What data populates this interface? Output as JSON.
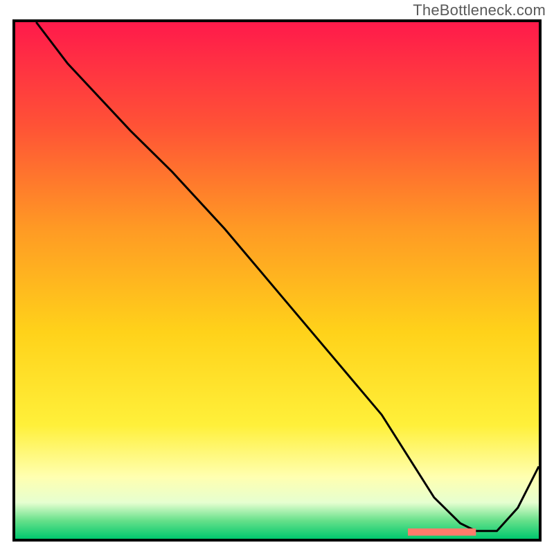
{
  "watermark": {
    "text": "TheBottleneck.com"
  },
  "chart_data": {
    "type": "line",
    "title": "",
    "xlabel": "",
    "ylabel": "",
    "xlim": [
      0,
      100
    ],
    "ylim": [
      0,
      100
    ],
    "grid": false,
    "legend": false,
    "background_gradient": {
      "direction": "vertical",
      "stops": [
        {
          "pos": 0.0,
          "color": "#ff1a4b"
        },
        {
          "pos": 0.2,
          "color": "#ff5236"
        },
        {
          "pos": 0.4,
          "color": "#ff9a24"
        },
        {
          "pos": 0.6,
          "color": "#ffd21a"
        },
        {
          "pos": 0.78,
          "color": "#fff03a"
        },
        {
          "pos": 0.88,
          "color": "#ffffb0"
        },
        {
          "pos": 0.93,
          "color": "#e6ffd0"
        },
        {
          "pos": 0.965,
          "color": "#66e08a"
        },
        {
          "pos": 1.0,
          "color": "#00c86e"
        }
      ]
    },
    "series": [
      {
        "name": "curve",
        "color": "#000000",
        "x": [
          4,
          10,
          22,
          30,
          40,
          50,
          60,
          70,
          75,
          80,
          85,
          88,
          92,
          96,
          100
        ],
        "values": [
          100,
          92,
          79,
          71,
          60,
          48,
          36,
          24,
          16,
          8,
          3,
          1.5,
          1.5,
          6,
          14
        ]
      }
    ],
    "flat_marker": {
      "color": "#ff7b6b",
      "y": 1.3,
      "x_start": 75,
      "x_end": 88,
      "thickness": 1.4
    }
  }
}
